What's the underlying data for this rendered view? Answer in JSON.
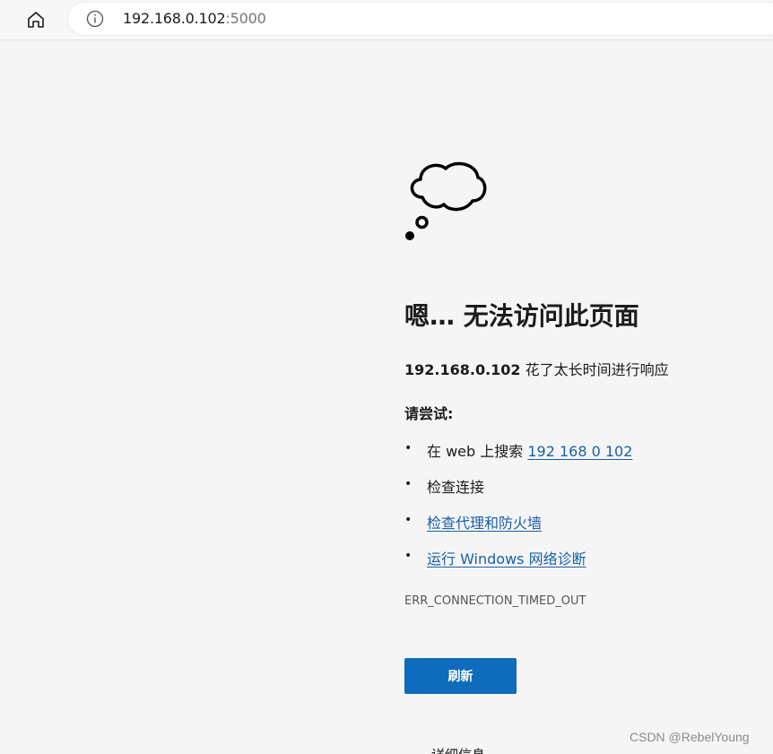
{
  "browser": {
    "address_bar": {
      "host": "192.168.0.102",
      "port": ":5000"
    },
    "icons": {
      "home": "home-icon",
      "info": "info-icon"
    }
  },
  "error_page": {
    "icon": "thought-cloud-icon",
    "title": "嗯… 无法访问此页面",
    "subtitle_host": "192.168.0.102",
    "subtitle_rest": " 花了太长时间进行响应",
    "try_heading": "请尝试:",
    "bullet": "•",
    "suggestions": [
      {
        "prefix": "在 web 上搜索 ",
        "link": "192 168 0 102"
      },
      {
        "text": "检查连接"
      },
      {
        "link": "检查代理和防火墙"
      },
      {
        "link": "运行 Windows 网络诊断"
      }
    ],
    "error_code": "ERR_CONNECTION_TIMED_OUT",
    "refresh_label": "刷新",
    "details_label": "详细信息"
  },
  "watermark": "CSDN @RebelYoung",
  "colors": {
    "link": "#1a5fa8",
    "button": "#0f6cbd",
    "background": "#f5f5f5"
  }
}
